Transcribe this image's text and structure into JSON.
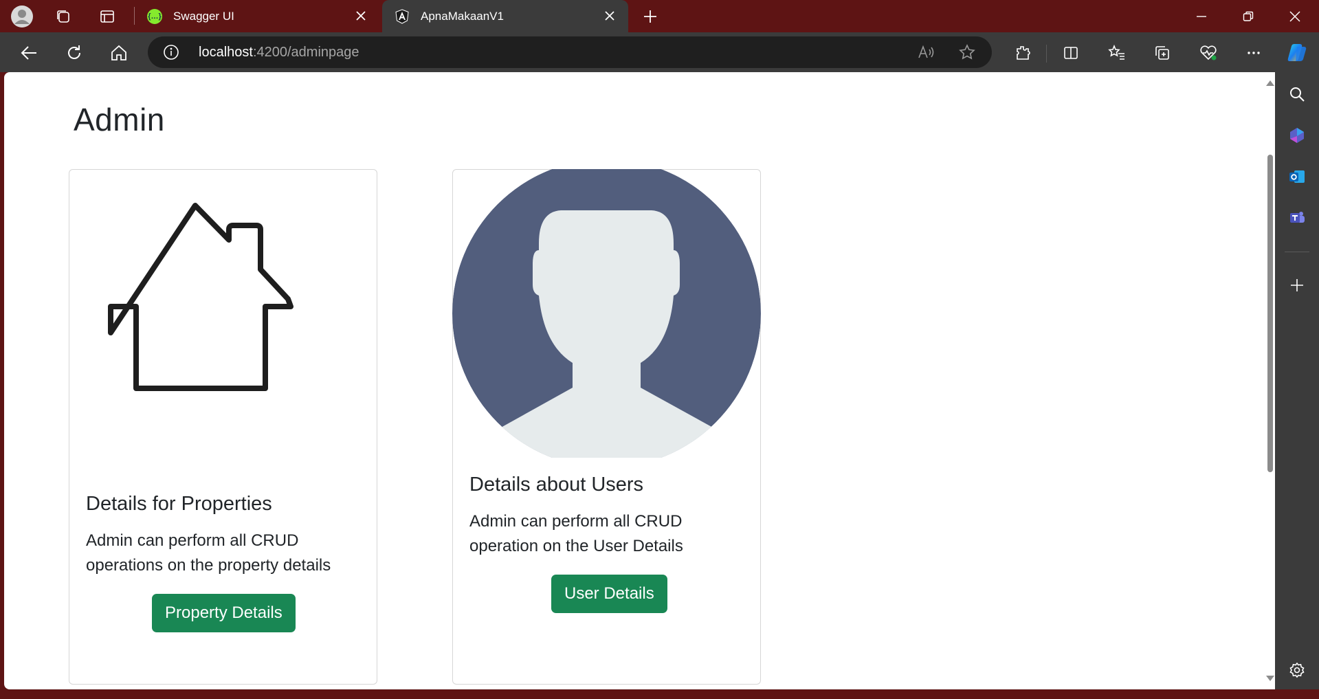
{
  "browser": {
    "tabs": [
      {
        "title": "Swagger UI",
        "favicon": "swagger-icon",
        "active": false
      },
      {
        "title": "ApnaMakaanV1",
        "favicon": "angular-icon",
        "active": true
      }
    ],
    "url": {
      "host": "localhost",
      "path": ":4200/adminpage"
    }
  },
  "page": {
    "title": "Admin",
    "cards": [
      {
        "image": "house-outline-icon",
        "title": "Details for Properties",
        "text": "Admin can perform all CRUD operations on the property details",
        "button": "Property Details"
      },
      {
        "image": "user-avatar-icon",
        "title": "Details about Users",
        "text": "Admin can perform all CRUD operation on the User Details",
        "button": "User Details"
      }
    ]
  },
  "colors": {
    "title_bar": "#5e1414",
    "toolbar": "#3b3b3b",
    "button_green": "#198754",
    "avatar_bg": "#525e7d",
    "avatar_fg": "#e6ebec"
  }
}
